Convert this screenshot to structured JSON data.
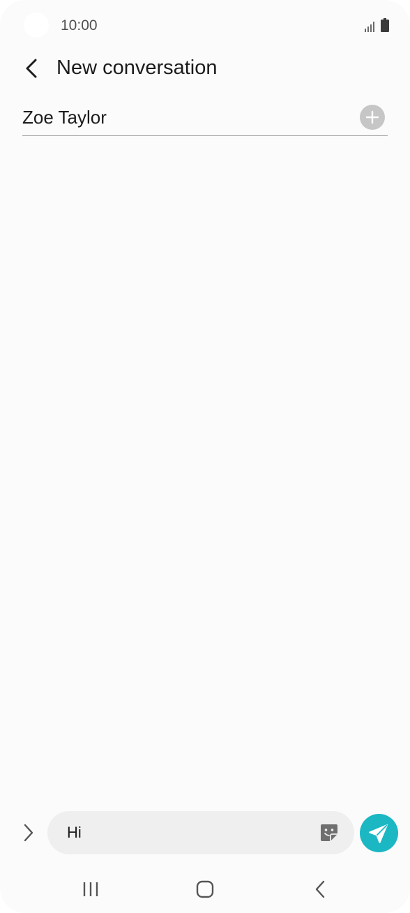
{
  "status_bar": {
    "time": "10:00"
  },
  "app_bar": {
    "title": "New conversation",
    "back_icon": "chevron-left-icon"
  },
  "recipient": {
    "value": "Zoe Taylor",
    "add_icon": "plus-icon"
  },
  "composer": {
    "message_value": "Hi",
    "expand_icon": "chevron-right-icon",
    "sticker_icon": "sticker-icon",
    "send_icon": "send-icon"
  },
  "nav_bar": {
    "recents_icon": "recents-icon",
    "home_icon": "home-icon",
    "back_icon": "back-icon"
  },
  "colors": {
    "accent": "#1bb7c3",
    "background": "#fbfbfb",
    "text_primary": "#1c1c1c",
    "text_secondary": "#505050",
    "input_bg": "#efefef",
    "icon_gray": "#6f6f6f"
  }
}
